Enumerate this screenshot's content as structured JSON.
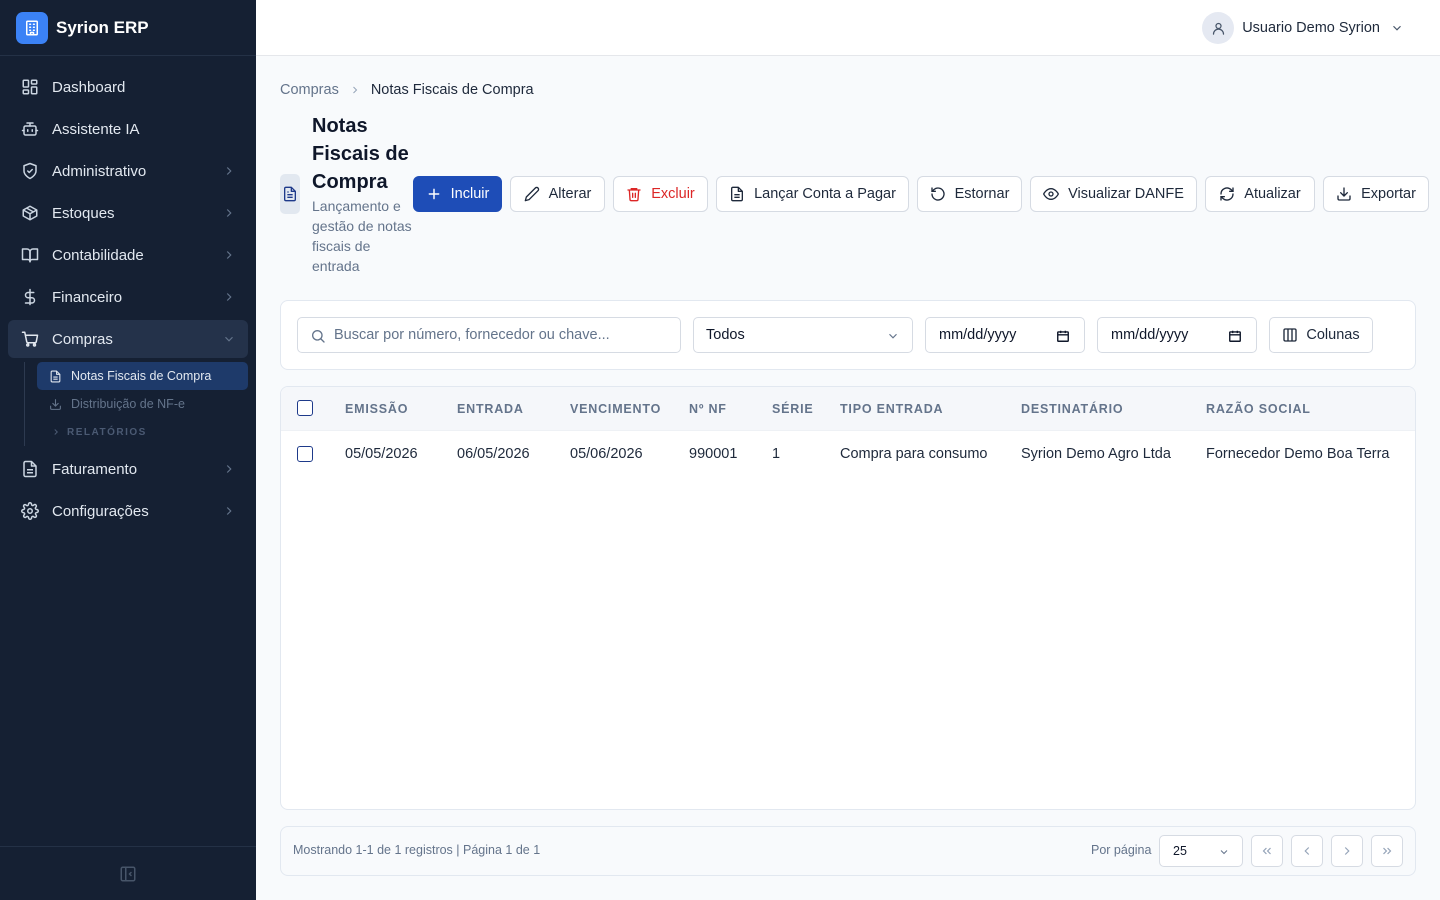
{
  "app": {
    "name": "Syrion ERP",
    "logo_icon": "building-icon",
    "accent": "#1e4db7",
    "sidebar_bg": "#152033"
  },
  "user": {
    "name": "Usuario Demo Syrion"
  },
  "sidebar": {
    "items": [
      {
        "label": "Dashboard",
        "icon": "dashboard-icon",
        "has_children": false
      },
      {
        "label": "Assistente IA",
        "icon": "bot-icon",
        "has_children": false
      },
      {
        "label": "Administrativo",
        "icon": "shield-icon",
        "has_children": true
      },
      {
        "label": "Estoques",
        "icon": "box-icon",
        "has_children": true
      },
      {
        "label": "Contabilidade",
        "icon": "book-icon",
        "has_children": true
      },
      {
        "label": "Financeiro",
        "icon": "dollar-icon",
        "has_children": true
      },
      {
        "label": "Compras",
        "icon": "cart-icon",
        "has_children": true,
        "expanded": true
      },
      {
        "label": "Faturamento",
        "icon": "file-icon",
        "has_children": true
      },
      {
        "label": "Configurações",
        "icon": "gear-icon",
        "has_children": true
      }
    ],
    "compras_children": [
      {
        "label": "Notas Fiscais de Compra",
        "active": true
      },
      {
        "label": "Distribuição de NF-e",
        "active": false
      }
    ],
    "compras_group": "RELATÓRIOS"
  },
  "breadcrumb": {
    "parent": "Compras",
    "current": "Notas Fiscais de Compra"
  },
  "page": {
    "title": "Notas Fiscais de Compra",
    "subtitle": "Lançamento e gestão de notas fiscais de entrada"
  },
  "toolbar": {
    "incluir": "Incluir",
    "alterar": "Alterar",
    "excluir": "Excluir",
    "lancar": "Lançar Conta a Pagar",
    "estornar": "Estornar",
    "danfe": "Visualizar DANFE",
    "atualizar": "Atualizar",
    "exportar": "Exportar"
  },
  "filters": {
    "search_placeholder": "Buscar por número, fornecedor ou chave...",
    "search_value": "",
    "status": "Todos",
    "date_from": "mm/dd/yyyy",
    "date_to": "mm/dd/yyyy",
    "columns": "Colunas"
  },
  "table": {
    "headers": [
      "EMISSÃO",
      "ENTRADA",
      "VENCIMENTO",
      "Nº NF",
      "SÉRIE",
      "TIPO ENTRADA",
      "DESTINATÁRIO",
      "RAZÃO SOCIAL"
    ],
    "rows": [
      [
        "05/05/2026",
        "06/05/2026",
        "05/06/2026",
        "990001",
        "1",
        "Compra para consumo",
        "Syrion Demo Agro Ltda",
        "Fornecedor Demo Boa Terra"
      ]
    ]
  },
  "pagination": {
    "info": "Mostrando 1-1 de 1 registros | Página 1 de 1",
    "per_page_label": "Por página",
    "per_page": "25"
  }
}
